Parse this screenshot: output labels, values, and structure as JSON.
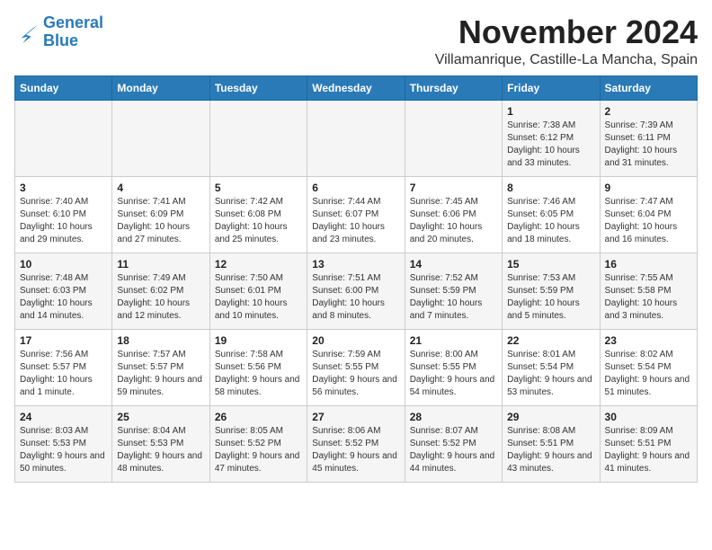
{
  "header": {
    "logo_line1": "General",
    "logo_line2": "Blue",
    "month": "November 2024",
    "location": "Villamanrique, Castille-La Mancha, Spain"
  },
  "weekdays": [
    "Sunday",
    "Monday",
    "Tuesday",
    "Wednesday",
    "Thursday",
    "Friday",
    "Saturday"
  ],
  "weeks": [
    [
      {
        "day": "",
        "info": ""
      },
      {
        "day": "",
        "info": ""
      },
      {
        "day": "",
        "info": ""
      },
      {
        "day": "",
        "info": ""
      },
      {
        "day": "",
        "info": ""
      },
      {
        "day": "1",
        "info": "Sunrise: 7:38 AM\nSunset: 6:12 PM\nDaylight: 10 hours and 33 minutes."
      },
      {
        "day": "2",
        "info": "Sunrise: 7:39 AM\nSunset: 6:11 PM\nDaylight: 10 hours and 31 minutes."
      }
    ],
    [
      {
        "day": "3",
        "info": "Sunrise: 7:40 AM\nSunset: 6:10 PM\nDaylight: 10 hours and 29 minutes."
      },
      {
        "day": "4",
        "info": "Sunrise: 7:41 AM\nSunset: 6:09 PM\nDaylight: 10 hours and 27 minutes."
      },
      {
        "day": "5",
        "info": "Sunrise: 7:42 AM\nSunset: 6:08 PM\nDaylight: 10 hours and 25 minutes."
      },
      {
        "day": "6",
        "info": "Sunrise: 7:44 AM\nSunset: 6:07 PM\nDaylight: 10 hours and 23 minutes."
      },
      {
        "day": "7",
        "info": "Sunrise: 7:45 AM\nSunset: 6:06 PM\nDaylight: 10 hours and 20 minutes."
      },
      {
        "day": "8",
        "info": "Sunrise: 7:46 AM\nSunset: 6:05 PM\nDaylight: 10 hours and 18 minutes."
      },
      {
        "day": "9",
        "info": "Sunrise: 7:47 AM\nSunset: 6:04 PM\nDaylight: 10 hours and 16 minutes."
      }
    ],
    [
      {
        "day": "10",
        "info": "Sunrise: 7:48 AM\nSunset: 6:03 PM\nDaylight: 10 hours and 14 minutes."
      },
      {
        "day": "11",
        "info": "Sunrise: 7:49 AM\nSunset: 6:02 PM\nDaylight: 10 hours and 12 minutes."
      },
      {
        "day": "12",
        "info": "Sunrise: 7:50 AM\nSunset: 6:01 PM\nDaylight: 10 hours and 10 minutes."
      },
      {
        "day": "13",
        "info": "Sunrise: 7:51 AM\nSunset: 6:00 PM\nDaylight: 10 hours and 8 minutes."
      },
      {
        "day": "14",
        "info": "Sunrise: 7:52 AM\nSunset: 5:59 PM\nDaylight: 10 hours and 7 minutes."
      },
      {
        "day": "15",
        "info": "Sunrise: 7:53 AM\nSunset: 5:59 PM\nDaylight: 10 hours and 5 minutes."
      },
      {
        "day": "16",
        "info": "Sunrise: 7:55 AM\nSunset: 5:58 PM\nDaylight: 10 hours and 3 minutes."
      }
    ],
    [
      {
        "day": "17",
        "info": "Sunrise: 7:56 AM\nSunset: 5:57 PM\nDaylight: 10 hours and 1 minute."
      },
      {
        "day": "18",
        "info": "Sunrise: 7:57 AM\nSunset: 5:57 PM\nDaylight: 9 hours and 59 minutes."
      },
      {
        "day": "19",
        "info": "Sunrise: 7:58 AM\nSunset: 5:56 PM\nDaylight: 9 hours and 58 minutes."
      },
      {
        "day": "20",
        "info": "Sunrise: 7:59 AM\nSunset: 5:55 PM\nDaylight: 9 hours and 56 minutes."
      },
      {
        "day": "21",
        "info": "Sunrise: 8:00 AM\nSunset: 5:55 PM\nDaylight: 9 hours and 54 minutes."
      },
      {
        "day": "22",
        "info": "Sunrise: 8:01 AM\nSunset: 5:54 PM\nDaylight: 9 hours and 53 minutes."
      },
      {
        "day": "23",
        "info": "Sunrise: 8:02 AM\nSunset: 5:54 PM\nDaylight: 9 hours and 51 minutes."
      }
    ],
    [
      {
        "day": "24",
        "info": "Sunrise: 8:03 AM\nSunset: 5:53 PM\nDaylight: 9 hours and 50 minutes."
      },
      {
        "day": "25",
        "info": "Sunrise: 8:04 AM\nSunset: 5:53 PM\nDaylight: 9 hours and 48 minutes."
      },
      {
        "day": "26",
        "info": "Sunrise: 8:05 AM\nSunset: 5:52 PM\nDaylight: 9 hours and 47 minutes."
      },
      {
        "day": "27",
        "info": "Sunrise: 8:06 AM\nSunset: 5:52 PM\nDaylight: 9 hours and 45 minutes."
      },
      {
        "day": "28",
        "info": "Sunrise: 8:07 AM\nSunset: 5:52 PM\nDaylight: 9 hours and 44 minutes."
      },
      {
        "day": "29",
        "info": "Sunrise: 8:08 AM\nSunset: 5:51 PM\nDaylight: 9 hours and 43 minutes."
      },
      {
        "day": "30",
        "info": "Sunrise: 8:09 AM\nSunset: 5:51 PM\nDaylight: 9 hours and 41 minutes."
      }
    ]
  ]
}
